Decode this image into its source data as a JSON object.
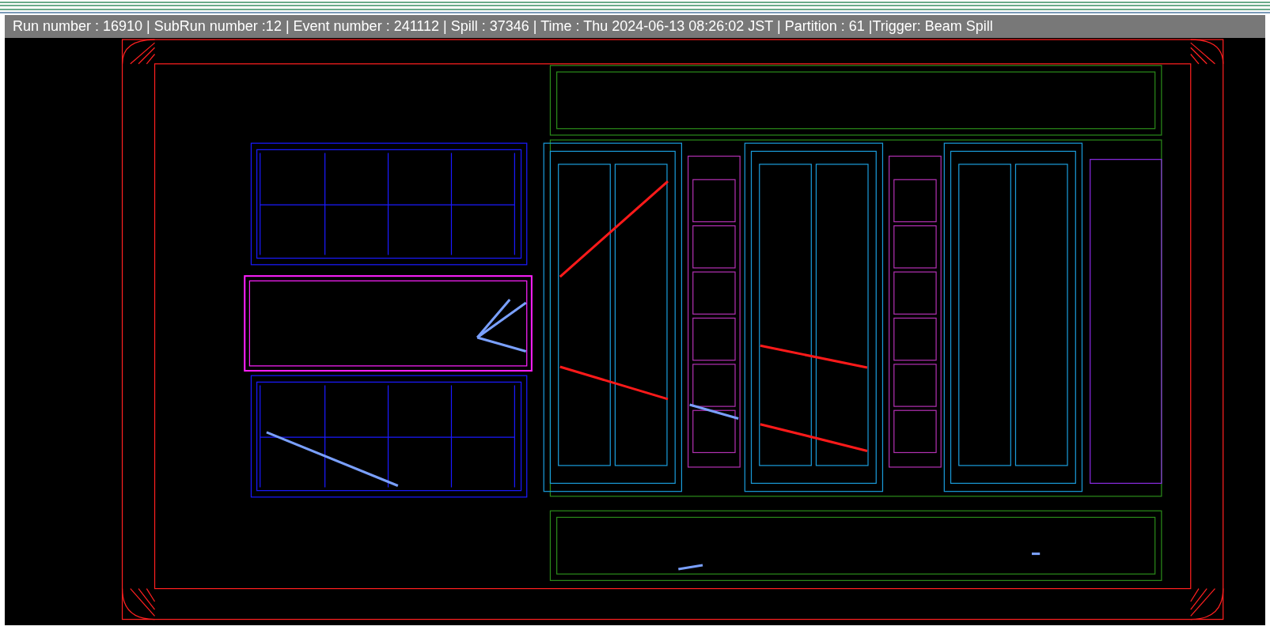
{
  "info_bar": {
    "text": "Run number : 16910 | SubRun number :12 | Event number : 241112 | Spill : 37346 | Time : Thu 2024-06-13 08:26:02 JST | Partition : 61 |Trigger: Beam Spill"
  }
}
